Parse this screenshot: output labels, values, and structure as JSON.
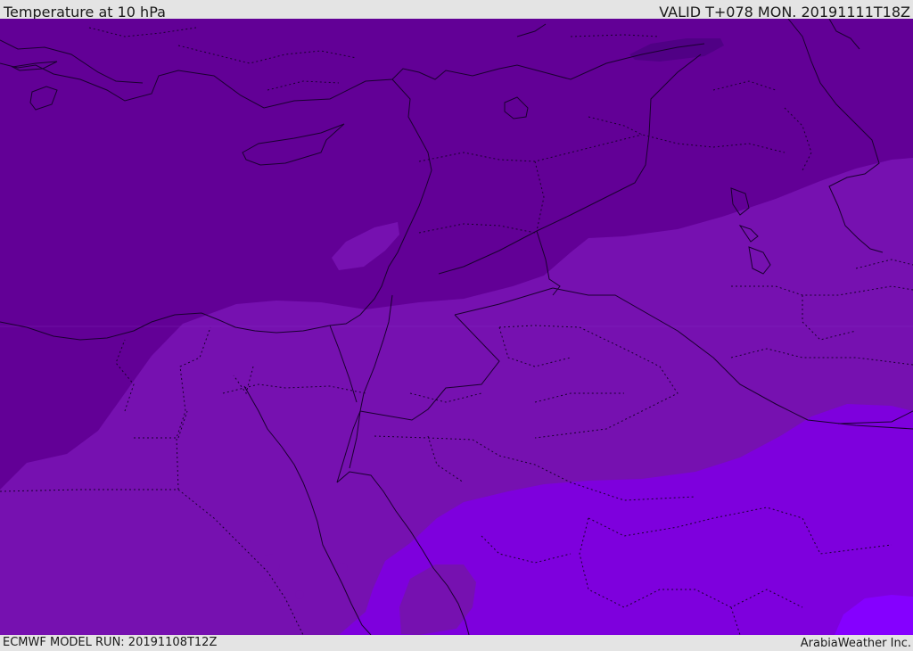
{
  "header": {
    "title": "Temperature at 10 hPa",
    "valid": "VALID T+078 MON. 20191111T18Z"
  },
  "footer": {
    "model_run": "ECMWF MODEL RUN: 20191108T12Z",
    "credit": "ArabiaWeather Inc."
  },
  "map": {
    "shading_colors": {
      "coldest": "#500085",
      "cold": "#620096",
      "mid": "#7611b0",
      "warm": "#7e00dd",
      "warmest": "#8500ff"
    },
    "border_color": "#1a0030"
  }
}
